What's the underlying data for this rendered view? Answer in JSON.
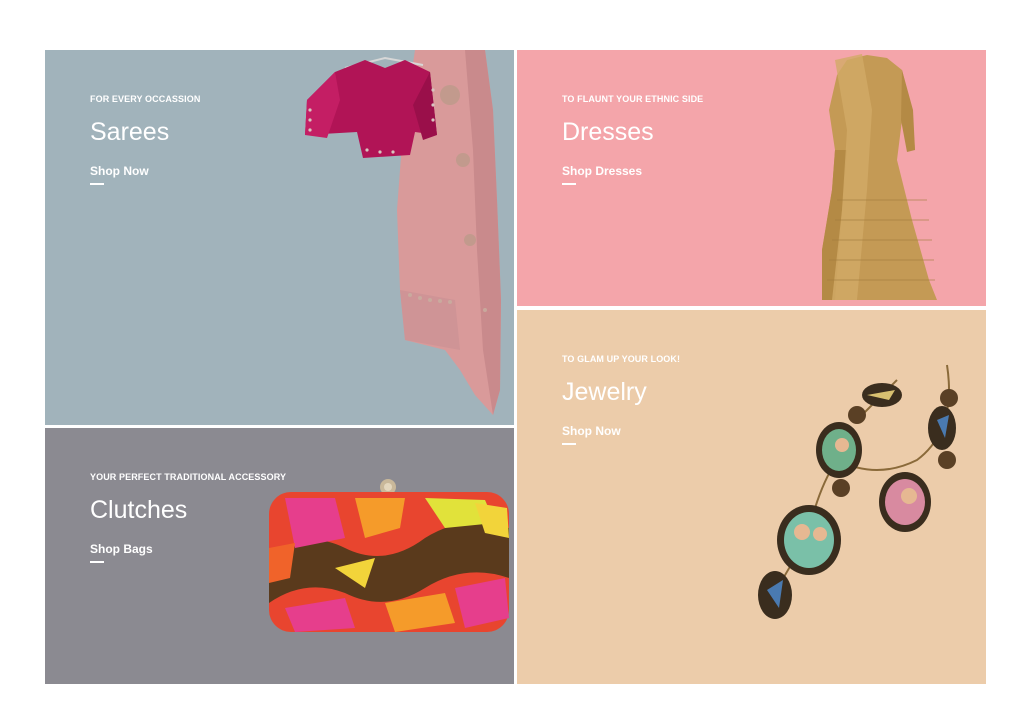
{
  "colors": {
    "sarees_bg": "#a1b3bb",
    "dresses_bg": "#f4a5aa",
    "clutches_bg": "#8b8a91",
    "jewelry_bg": "#ecccaa",
    "text": "#ffffff"
  },
  "tiles": [
    {
      "id": "sarees",
      "eyebrow": "FOR EVERY OCCASSION",
      "title": "Sarees",
      "link": "Shop Now",
      "image": "pink-saree-with-magenta-blouse"
    },
    {
      "id": "dresses",
      "eyebrow": "TO FLAUNT YOUR ETHNIC SIDE",
      "title": "Dresses",
      "link": "Shop Dresses",
      "image": "gold-anarkali-dress"
    },
    {
      "id": "clutches",
      "eyebrow": "YOUR PERFECT TRADITIONAL ACCESSORY",
      "title": "Clutches",
      "link": "Shop Bags",
      "image": "beaded-multicolor-clutch"
    },
    {
      "id": "jewelry",
      "eyebrow": "TO GLAM UP YOUR LOOK!",
      "title": "Jewelry",
      "link": "Shop Now",
      "image": "painted-medallion-necklace"
    }
  ]
}
